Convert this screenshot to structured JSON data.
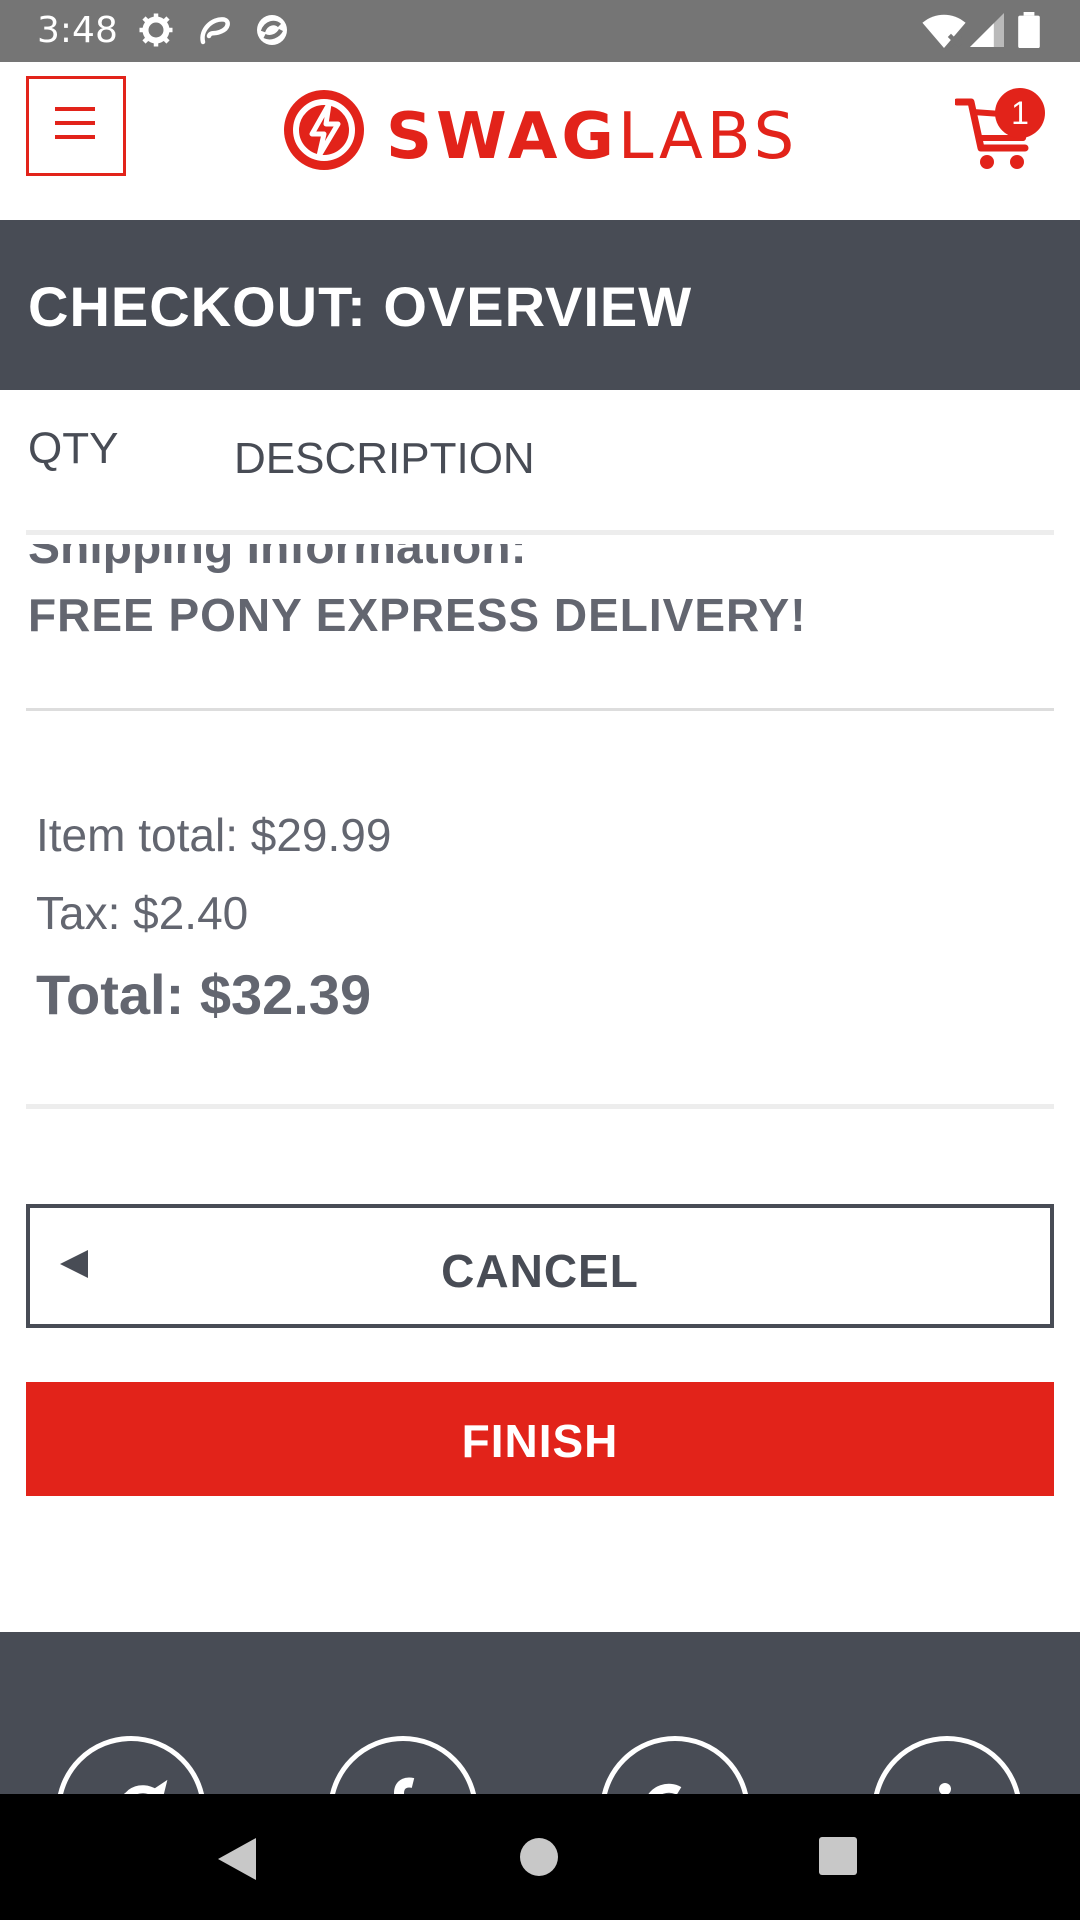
{
  "status_bar": {
    "time": "3:48"
  },
  "header": {
    "logo_bold": "SWAG",
    "logo_light": "LABS",
    "cart_count": "1"
  },
  "page": {
    "title": "CHECKOUT: OVERVIEW"
  },
  "columns": {
    "qty": "QTY",
    "description": "DESCRIPTION"
  },
  "shipping": {
    "label": "Shipping Information:",
    "value": "FREE PONY EXPRESS DELIVERY!"
  },
  "summary": {
    "item_total": "Item total: $29.99",
    "tax": "Tax: $2.40",
    "total": "Total: $32.39"
  },
  "actions": {
    "cancel_label": "CANCEL",
    "finish_label": "FINISH"
  },
  "colors": {
    "brand_red": "#e2231a",
    "dark_gray": "#484c55"
  }
}
